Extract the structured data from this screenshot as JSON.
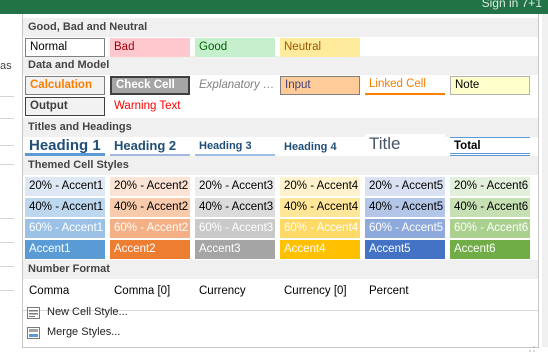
{
  "window": {
    "signin_text": "Sign in  7+1"
  },
  "background": {
    "left_fragment": "as"
  },
  "sections": [
    {
      "key": "gbn",
      "header": "Good, Bad and Neutral"
    },
    {
      "key": "dm",
      "header": "Data and Model"
    },
    {
      "key": "th",
      "header": "Titles and Headings"
    },
    {
      "key": "tcs",
      "header": "Themed Cell Styles"
    },
    {
      "key": "nf",
      "header": "Number Format"
    }
  ],
  "cells": [
    {
      "name": "style-normal",
      "label": "Normal",
      "color": "#000000",
      "bg": "#ffffff"
    },
    {
      "name": "style-bad",
      "label": "Bad",
      "color": "#9c0006",
      "bg": "#ffc7ce"
    },
    {
      "name": "style-good",
      "label": "Good",
      "color": "#006100",
      "bg": "#c6efce"
    },
    {
      "name": "style-neutral",
      "label": "Neutral",
      "color": "#9c5700",
      "bg": "#ffeb9c"
    },
    {
      "name": "style-calculation",
      "label": "Calculation",
      "color": "#fa7d00",
      "bg": "#f2f2f2"
    },
    {
      "name": "style-check-cell",
      "label": "Check Cell",
      "color": "#ffffff",
      "bg": "#a5a5a5"
    },
    {
      "name": "style-explanatory-text",
      "label": "Explanatory T...",
      "color": "#7f7f7f",
      "bg": "#ffffff"
    },
    {
      "name": "style-input",
      "label": "Input",
      "color": "#3f3f76",
      "bg": "#ffcc99"
    },
    {
      "name": "style-linked-cell",
      "label": "Linked Cell",
      "color": "#fa7d00",
      "bg": "#ffffff"
    },
    {
      "name": "style-note",
      "label": "Note",
      "color": "#000000",
      "bg": "#ffffcc"
    },
    {
      "name": "style-output",
      "label": "Output",
      "color": "#3f3f3f",
      "bg": "#f2f2f2"
    },
    {
      "name": "style-warning-text",
      "label": "Warning Text",
      "color": "#ff0000",
      "bg": "#ffffff"
    },
    {
      "name": "style-heading-1",
      "label": "Heading 1",
      "color": "#1f4e78",
      "bg": "#ffffff"
    },
    {
      "name": "style-heading-2",
      "label": "Heading 2",
      "color": "#1f4e78",
      "bg": "#ffffff"
    },
    {
      "name": "style-heading-3",
      "label": "Heading 3",
      "color": "#1f4e78",
      "bg": "#ffffff"
    },
    {
      "name": "style-heading-4",
      "label": "Heading 4",
      "color": "#1f4e78",
      "bg": "#ffffff"
    },
    {
      "name": "style-title",
      "label": "Title",
      "color": "#44546a",
      "bg": "#ffffff"
    },
    {
      "name": "style-total",
      "label": "Total",
      "color": "#000000",
      "bg": "#ffffff"
    },
    {
      "name": "style-20-accent1",
      "label": "20% - Accent1",
      "color": "#000000",
      "bg": "#dde8f4"
    },
    {
      "name": "style-20-accent2",
      "label": "20% - Accent2",
      "color": "#000000",
      "bg": "#fbe4d6"
    },
    {
      "name": "style-20-accent3",
      "label": "20% - Accent3",
      "color": "#000000",
      "bg": "#ededed"
    },
    {
      "name": "style-20-accent4",
      "label": "20% - Accent4",
      "color": "#000000",
      "bg": "#fff2cc"
    },
    {
      "name": "style-20-accent5",
      "label": "20% - Accent5",
      "color": "#000000",
      "bg": "#d9e1f2"
    },
    {
      "name": "style-20-accent6",
      "label": "20% - Accent6",
      "color": "#000000",
      "bg": "#e2efda"
    },
    {
      "name": "style-40-accent1",
      "label": "40% - Accent1",
      "color": "#000000",
      "bg": "#bdd7ee"
    },
    {
      "name": "style-40-accent2",
      "label": "40% - Accent2",
      "color": "#000000",
      "bg": "#f8cbad"
    },
    {
      "name": "style-40-accent3",
      "label": "40% - Accent3",
      "color": "#000000",
      "bg": "#dbdbdb"
    },
    {
      "name": "style-40-accent4",
      "label": "40% - Accent4",
      "color": "#000000",
      "bg": "#ffe699"
    },
    {
      "name": "style-40-accent5",
      "label": "40% - Accent5",
      "color": "#000000",
      "bg": "#b4c6e7"
    },
    {
      "name": "style-40-accent6",
      "label": "40% - Accent6",
      "color": "#000000",
      "bg": "#c6e0b4"
    },
    {
      "name": "style-60-accent1",
      "label": "60% - Accent1",
      "color": "#ffffff",
      "bg": "#9bc2e6"
    },
    {
      "name": "style-60-accent2",
      "label": "60% - Accent2",
      "color": "#ffffff",
      "bg": "#f4b084"
    },
    {
      "name": "style-60-accent3",
      "label": "60% - Accent3",
      "color": "#ffffff",
      "bg": "#c9c9c9"
    },
    {
      "name": "style-60-accent4",
      "label": "60% - Accent4",
      "color": "#ffffff",
      "bg": "#ffd966"
    },
    {
      "name": "style-60-accent5",
      "label": "60% - Accent5",
      "color": "#ffffff",
      "bg": "#8ea9db"
    },
    {
      "name": "style-60-accent6",
      "label": "60% - Accent6",
      "color": "#ffffff",
      "bg": "#a9d08e"
    },
    {
      "name": "style-accent1",
      "label": "Accent1",
      "color": "#ffffff",
      "bg": "#5b9bd5"
    },
    {
      "name": "style-accent2",
      "label": "Accent2",
      "color": "#ffffff",
      "bg": "#ed7d31"
    },
    {
      "name": "style-accent3",
      "label": "Accent3",
      "color": "#ffffff",
      "bg": "#a5a5a5"
    },
    {
      "name": "style-accent4",
      "label": "Accent4",
      "color": "#ffffff",
      "bg": "#ffc000"
    },
    {
      "name": "style-accent5",
      "label": "Accent5",
      "color": "#ffffff",
      "bg": "#4472c4"
    },
    {
      "name": "style-accent6",
      "label": "Accent6",
      "color": "#ffffff",
      "bg": "#70ad47"
    },
    {
      "name": "style-comma",
      "label": "Comma",
      "color": "#000000",
      "bg": "#ffffff"
    },
    {
      "name": "style-comma-0",
      "label": "Comma [0]",
      "color": "#000000",
      "bg": "#ffffff"
    },
    {
      "name": "style-currency",
      "label": "Currency",
      "color": "#000000",
      "bg": "#ffffff"
    },
    {
      "name": "style-currency-0",
      "label": "Currency [0]",
      "color": "#000000",
      "bg": "#ffffff"
    },
    {
      "name": "style-percent",
      "label": "Percent",
      "color": "#000000",
      "bg": "#ffffff"
    }
  ],
  "menu": [
    {
      "name": "new-cell-style-item",
      "label": "New Cell Style...",
      "icon": "new-style-icon"
    },
    {
      "name": "merge-styles-item",
      "label": "Merge Styles...",
      "icon": "merge-styles-icon"
    }
  ]
}
